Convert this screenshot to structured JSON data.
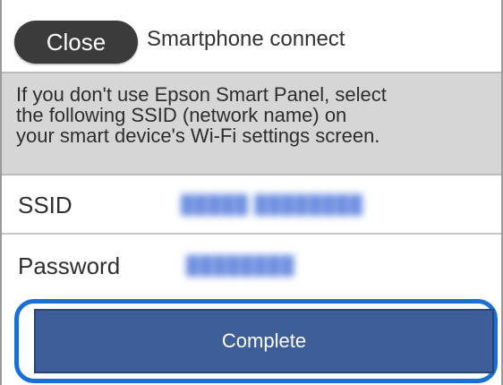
{
  "header": {
    "close_label": "Close",
    "title": "Smartphone connect"
  },
  "info": {
    "message": "If you don't use Epson Smart Panel, select\nthe following SSID (network name) on\nyour smart device's Wi-Fi settings screen."
  },
  "fields": {
    "ssid_label": "SSID",
    "ssid_value": "",
    "password_label": "Password",
    "password_value": ""
  },
  "footer": {
    "complete_label": "Complete"
  },
  "colors": {
    "close_button_bg": "#3b3b3b",
    "info_panel_bg": "#d6d6d6",
    "complete_button_bg": "#3e5e99",
    "focus_ring": "#1a6fd6",
    "redacted_value": "#6d8fe0"
  }
}
